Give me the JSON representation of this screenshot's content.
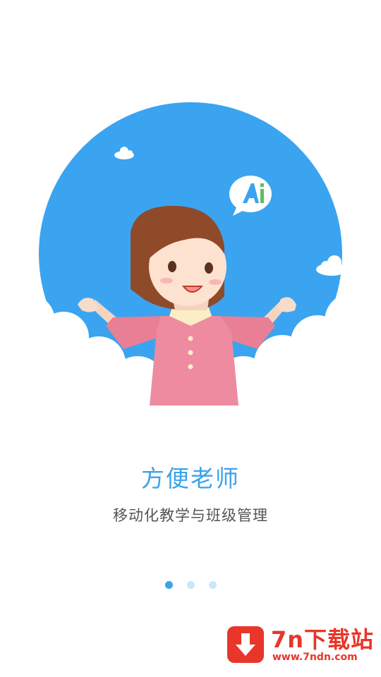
{
  "slide": {
    "title": "方便老师",
    "subtitle": "移动化教学与班级管理",
    "speech_bubble_text": "Ai"
  },
  "pager": {
    "total": 3,
    "current": 1
  },
  "watermark": {
    "name": "7n下载站",
    "url": "www.7ndn.com"
  },
  "colors": {
    "accent": "#3ba2eb",
    "sky": "#3aa4f0",
    "dot_inactive": "#c9e6fb",
    "watermark_red": "#e8362a"
  }
}
